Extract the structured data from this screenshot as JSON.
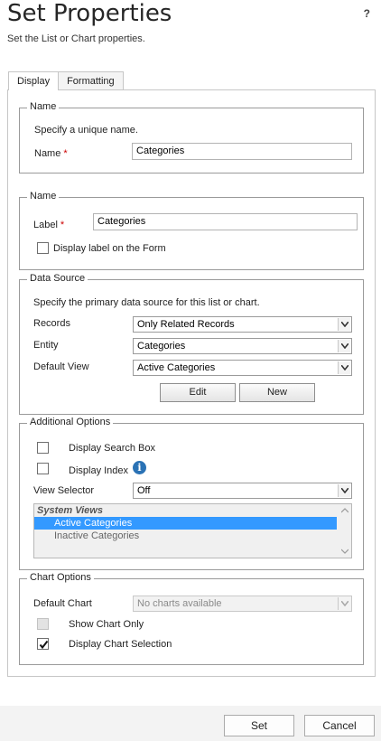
{
  "header": {
    "title": "Set Properties",
    "subtitle": "Set the List or Chart properties.",
    "help_label": "?"
  },
  "tabs": [
    {
      "label": "Display",
      "active": true
    },
    {
      "label": "Formatting",
      "active": false
    }
  ],
  "name_section": {
    "legend": "Name",
    "description": "Specify a unique name.",
    "field_label": "Name",
    "required_mark": "*",
    "value": "Categories"
  },
  "label_section": {
    "legend": "Name",
    "field_label": "Label",
    "required_mark": "*",
    "value": "Categories",
    "display_label_checkbox": "Display label on the Form",
    "display_label_checked": false
  },
  "data_source": {
    "legend": "Data Source",
    "description": "Specify the primary data source for this list or chart.",
    "records_label": "Records",
    "records_value": "Only Related Records",
    "entity_label": "Entity",
    "entity_value": "Categories",
    "default_view_label": "Default View",
    "default_view_value": "Active Categories",
    "edit_button": "Edit",
    "new_button": "New"
  },
  "additional_options": {
    "legend": "Additional Options",
    "search_box_label": "Display Search Box",
    "search_box_checked": false,
    "display_index_label": "Display Index",
    "display_index_checked": false,
    "info_glyph": "i",
    "view_selector_label": "View Selector",
    "view_selector_value": "Off",
    "views_header": "System Views",
    "views": [
      {
        "label": "Active Categories",
        "selected": true
      },
      {
        "label": "Inactive Categories",
        "selected": false
      }
    ]
  },
  "chart_options": {
    "legend": "Chart Options",
    "default_chart_label": "Default Chart",
    "default_chart_value": "No charts available",
    "show_chart_only_label": "Show Chart Only",
    "show_chart_only_checked": false,
    "display_chart_selection_label": "Display Chart Selection",
    "display_chart_selection_checked": true
  },
  "footer": {
    "set_button": "Set",
    "cancel_button": "Cancel"
  },
  "colors": {
    "selected_row": "#3399ff",
    "required": "#cc0000",
    "info_icon": "#2a72b5"
  }
}
